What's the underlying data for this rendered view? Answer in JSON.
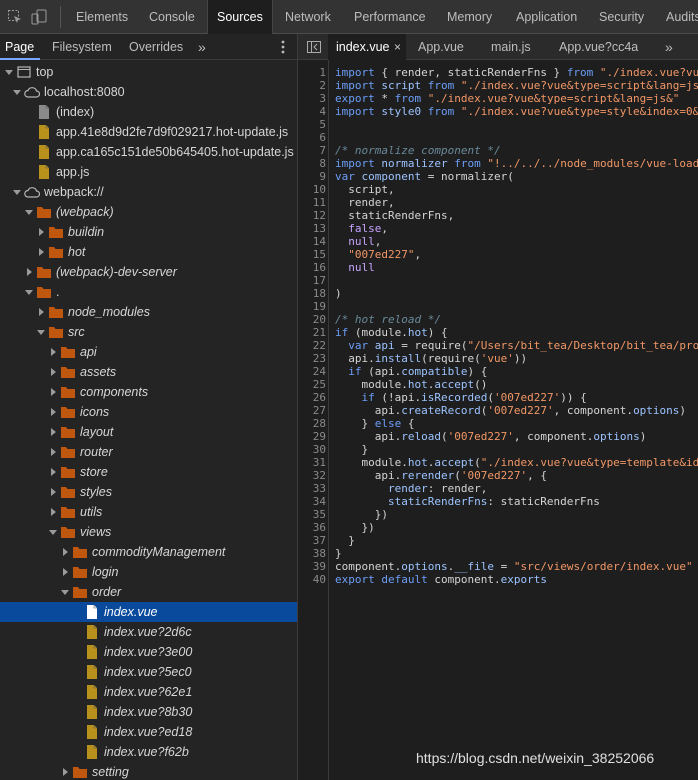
{
  "devtools_tabs": [
    "Elements",
    "Console",
    "Sources",
    "Network",
    "Performance",
    "Memory",
    "Application",
    "Security",
    "Audits"
  ],
  "navigator_tabs": [
    "Page",
    "Filesystem",
    "Overrides"
  ],
  "more_tabs_glyph": "»",
  "tree": [
    {
      "label": "top",
      "icon": "frame-icon",
      "arrow": "down",
      "depth": 0
    },
    {
      "label": "localhost:8080",
      "icon": "cloud-icon",
      "arrow": "down",
      "depth": 1
    },
    {
      "label": "(index)",
      "icon": "file-icon",
      "arrow": "none",
      "depth": 2,
      "file_color": "gray"
    },
    {
      "label": "app.41e8d9d2fe7d9f029217.hot-update.js",
      "icon": "file-icon",
      "arrow": "none",
      "depth": 2,
      "file_color": "yellow"
    },
    {
      "label": "app.ca165c151de50b645405.hot-update.js",
      "icon": "file-icon",
      "arrow": "none",
      "depth": 2,
      "file_color": "yellow"
    },
    {
      "label": "app.js",
      "icon": "file-icon",
      "arrow": "none",
      "depth": 2,
      "file_color": "yellow"
    },
    {
      "label": "webpack://",
      "icon": "cloud-icon",
      "arrow": "down",
      "depth": 1
    },
    {
      "label": "(webpack)",
      "icon": "folder-icon",
      "arrow": "down",
      "depth": 2,
      "italic": true
    },
    {
      "label": "buildin",
      "icon": "folder-icon",
      "arrow": "right",
      "depth": 3,
      "italic": true
    },
    {
      "label": "hot",
      "icon": "folder-icon",
      "arrow": "right",
      "depth": 3,
      "italic": true
    },
    {
      "label": "(webpack)-dev-server",
      "icon": "folder-icon",
      "arrow": "right",
      "depth": 2,
      "italic": true
    },
    {
      "label": ".",
      "icon": "folder-icon",
      "arrow": "down",
      "depth": 2
    },
    {
      "label": "node_modules",
      "icon": "folder-icon",
      "arrow": "right",
      "depth": 3,
      "italic": true
    },
    {
      "label": "src",
      "icon": "folder-icon",
      "arrow": "down",
      "depth": 3,
      "italic": true
    },
    {
      "label": "api",
      "icon": "folder-icon",
      "arrow": "right",
      "depth": 4,
      "italic": true
    },
    {
      "label": "assets",
      "icon": "folder-icon",
      "arrow": "right",
      "depth": 4,
      "italic": true
    },
    {
      "label": "components",
      "icon": "folder-icon",
      "arrow": "right",
      "depth": 4,
      "italic": true
    },
    {
      "label": "icons",
      "icon": "folder-icon",
      "arrow": "right",
      "depth": 4,
      "italic": true
    },
    {
      "label": "layout",
      "icon": "folder-icon",
      "arrow": "right",
      "depth": 4,
      "italic": true
    },
    {
      "label": "router",
      "icon": "folder-icon",
      "arrow": "right",
      "depth": 4,
      "italic": true
    },
    {
      "label": "store",
      "icon": "folder-icon",
      "arrow": "right",
      "depth": 4,
      "italic": true
    },
    {
      "label": "styles",
      "icon": "folder-icon",
      "arrow": "right",
      "depth": 4,
      "italic": true
    },
    {
      "label": "utils",
      "icon": "folder-icon",
      "arrow": "right",
      "depth": 4,
      "italic": true
    },
    {
      "label": "views",
      "icon": "folder-icon",
      "arrow": "down",
      "depth": 4,
      "italic": true
    },
    {
      "label": "commodityManagement",
      "icon": "folder-icon",
      "arrow": "right",
      "depth": 5,
      "italic": true
    },
    {
      "label": "login",
      "icon": "folder-icon",
      "arrow": "right",
      "depth": 5,
      "italic": true
    },
    {
      "label": "order",
      "icon": "folder-icon",
      "arrow": "down",
      "depth": 5,
      "italic": true
    },
    {
      "label": "index.vue",
      "icon": "file-icon",
      "arrow": "none",
      "depth": 6,
      "italic": true,
      "selected": true,
      "file_color": "white"
    },
    {
      "label": "index.vue?2d6c",
      "icon": "file-icon",
      "arrow": "none",
      "depth": 6,
      "italic": true,
      "file_color": "yellow"
    },
    {
      "label": "index.vue?3e00",
      "icon": "file-icon",
      "arrow": "none",
      "depth": 6,
      "italic": true,
      "file_color": "yellow"
    },
    {
      "label": "index.vue?5ec0",
      "icon": "file-icon",
      "arrow": "none",
      "depth": 6,
      "italic": true,
      "file_color": "yellow"
    },
    {
      "label": "index.vue?62e1",
      "icon": "file-icon",
      "arrow": "none",
      "depth": 6,
      "italic": true,
      "file_color": "yellow"
    },
    {
      "label": "index.vue?8b30",
      "icon": "file-icon",
      "arrow": "none",
      "depth": 6,
      "italic": true,
      "file_color": "yellow"
    },
    {
      "label": "index.vue?ed18",
      "icon": "file-icon",
      "arrow": "none",
      "depth": 6,
      "italic": true,
      "file_color": "yellow"
    },
    {
      "label": "index.vue?f62b",
      "icon": "file-icon",
      "arrow": "none",
      "depth": 6,
      "italic": true,
      "file_color": "yellow"
    },
    {
      "label": "setting",
      "icon": "folder-icon",
      "arrow": "right",
      "depth": 5,
      "italic": true
    }
  ],
  "editor_tabs": [
    {
      "label": "index.vue",
      "active": true,
      "closable": true
    },
    {
      "label": "App.vue"
    },
    {
      "label": "main.js"
    },
    {
      "label": "App.vue?cc4a"
    }
  ],
  "code_lines": [
    [
      [
        "k",
        "import"
      ],
      [
        "t",
        " { render, staticRenderFns } "
      ],
      [
        "k",
        "from"
      ],
      [
        "s",
        " \"./index.vue?vu"
      ]
    ],
    [
      [
        "k",
        "import"
      ],
      [
        "p",
        " script"
      ],
      [
        "k",
        " from"
      ],
      [
        "s",
        " \"./index.vue?vue&type=script&lang=js"
      ]
    ],
    [
      [
        "k",
        "export"
      ],
      [
        "t",
        " * "
      ],
      [
        "k",
        "from"
      ],
      [
        "s",
        " \"./index.vue?vue&type=script&lang=js&\""
      ]
    ],
    [
      [
        "k",
        "import"
      ],
      [
        "p",
        " style0"
      ],
      [
        "k",
        " from"
      ],
      [
        "s",
        " \"./index.vue?vue&type=style&index=0&"
      ]
    ],
    [],
    [],
    [
      [
        "c",
        "/* normalize component */"
      ]
    ],
    [
      [
        "k",
        "import"
      ],
      [
        "p",
        " normalizer"
      ],
      [
        "k",
        " from"
      ],
      [
        "s",
        " \"!../../../node_modules/vue-load"
      ]
    ],
    [
      [
        "k",
        "var"
      ],
      [
        "p",
        " component"
      ],
      [
        "t",
        " = normalizer("
      ]
    ],
    [
      [
        "t",
        "  script,"
      ]
    ],
    [
      [
        "t",
        "  render,"
      ]
    ],
    [
      [
        "t",
        "  staticRenderFns,"
      ]
    ],
    [
      [
        "lit",
        "  false"
      ],
      [
        "t",
        ","
      ]
    ],
    [
      [
        "lit",
        "  null"
      ],
      [
        "t",
        ","
      ]
    ],
    [
      [
        "s",
        "  \"007ed227\""
      ],
      [
        "t",
        ","
      ]
    ],
    [
      [
        "lit",
        "  null"
      ]
    ],
    [],
    [
      [
        "t",
        ")"
      ]
    ],
    [],
    [
      [
        "c",
        "/* hot reload */"
      ]
    ],
    [
      [
        "k",
        "if"
      ],
      [
        "t",
        " (module."
      ],
      [
        "p",
        "hot"
      ],
      [
        "t",
        ") {"
      ]
    ],
    [
      [
        "k",
        "  var"
      ],
      [
        "p",
        " api"
      ],
      [
        "t",
        " = require("
      ],
      [
        "s",
        "\"/Users/bit_tea/Desktop/bit_tea/pro"
      ]
    ],
    [
      [
        "t",
        "  api."
      ],
      [
        "p",
        "install"
      ],
      [
        "t",
        "(require("
      ],
      [
        "s",
        "'vue'"
      ],
      [
        "t",
        "))"
      ]
    ],
    [
      [
        "k",
        "  if"
      ],
      [
        "t",
        " (api."
      ],
      [
        "p",
        "compatible"
      ],
      [
        "t",
        ") {"
      ]
    ],
    [
      [
        "t",
        "    module."
      ],
      [
        "p",
        "hot"
      ],
      [
        "t",
        "."
      ],
      [
        "p",
        "accept"
      ],
      [
        "t",
        "()"
      ]
    ],
    [
      [
        "k",
        "    if"
      ],
      [
        "t",
        " (!api."
      ],
      [
        "p",
        "isRecorded"
      ],
      [
        "t",
        "("
      ],
      [
        "s",
        "'007ed227'"
      ],
      [
        "t",
        ")) {"
      ]
    ],
    [
      [
        "t",
        "      api."
      ],
      [
        "p",
        "createRecord"
      ],
      [
        "t",
        "("
      ],
      [
        "s",
        "'007ed227'"
      ],
      [
        "t",
        ", component."
      ],
      [
        "p",
        "options"
      ],
      [
        "t",
        ")"
      ]
    ],
    [
      [
        "t",
        "    } "
      ],
      [
        "k",
        "else"
      ],
      [
        "t",
        " {"
      ]
    ],
    [
      [
        "t",
        "      api."
      ],
      [
        "p",
        "reload"
      ],
      [
        "t",
        "("
      ],
      [
        "s",
        "'007ed227'"
      ],
      [
        "t",
        ", component."
      ],
      [
        "p",
        "options"
      ],
      [
        "t",
        ")"
      ]
    ],
    [
      [
        "t",
        "    }"
      ]
    ],
    [
      [
        "t",
        "    module."
      ],
      [
        "p",
        "hot"
      ],
      [
        "t",
        "."
      ],
      [
        "p",
        "accept"
      ],
      [
        "t",
        "("
      ],
      [
        "s",
        "\"./index.vue?vue&type=template&id"
      ]
    ],
    [
      [
        "t",
        "      api."
      ],
      [
        "p",
        "rerender"
      ],
      [
        "t",
        "("
      ],
      [
        "s",
        "'007ed227'"
      ],
      [
        "t",
        ", {"
      ]
    ],
    [
      [
        "p",
        "        render"
      ],
      [
        "t",
        ": render,"
      ]
    ],
    [
      [
        "p",
        "        staticRenderFns"
      ],
      [
        "t",
        ": staticRenderFns"
      ]
    ],
    [
      [
        "t",
        "      })"
      ]
    ],
    [
      [
        "t",
        "    })"
      ]
    ],
    [
      [
        "t",
        "  }"
      ]
    ],
    [
      [
        "t",
        "}"
      ]
    ],
    [
      [
        "t",
        "component."
      ],
      [
        "p",
        "options"
      ],
      [
        "t",
        "."
      ],
      [
        "p",
        "__file"
      ],
      [
        "t",
        " = "
      ],
      [
        "s",
        "\"src/views/order/index.vue\""
      ]
    ],
    [
      [
        "k",
        "export"
      ],
      [
        "k",
        " default"
      ],
      [
        "t",
        " component."
      ],
      [
        "p",
        "exports"
      ]
    ]
  ],
  "watermark": "https://blog.csdn.net/weixin_38252066",
  "colors": {
    "selection": "#0a4a9c",
    "folder": "#c0570f",
    "file_js": "#b8901c"
  }
}
